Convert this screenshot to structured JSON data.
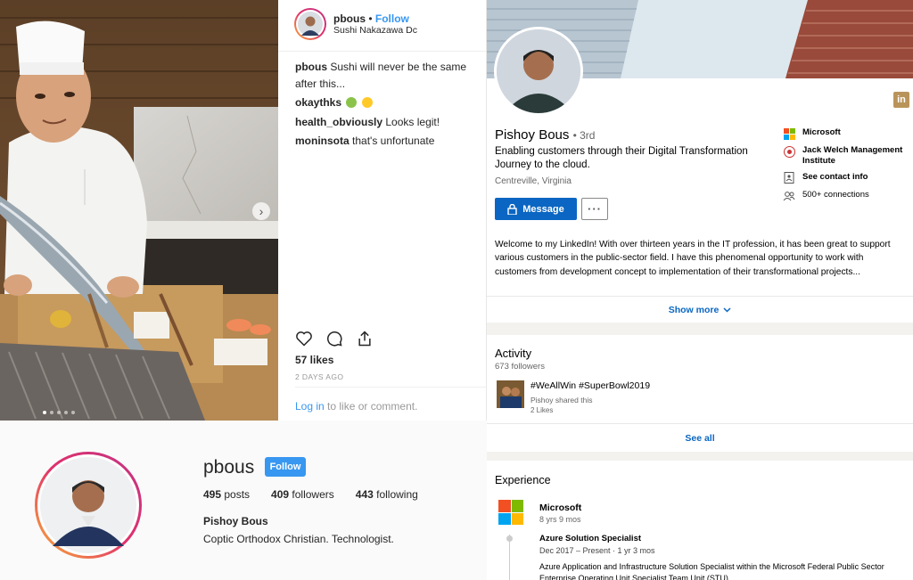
{
  "post": {
    "username": "pbous",
    "separator": "•",
    "follow_label": "Follow",
    "location": "Sushi Nakazawa Dc",
    "comments": [
      {
        "user": "pbous",
        "text": "Sushi will never be the same after this..."
      },
      {
        "user": "okaythks",
        "text": ""
      },
      {
        "user": "health_obviously",
        "text": "Looks legit!"
      },
      {
        "user": "moninsota",
        "text": "that's unfortunate"
      }
    ],
    "likes": "57 likes",
    "time_ago": "2 DAYS AGO",
    "login_link": "Log in",
    "login_rest": " to like or comment.",
    "carousel": {
      "total": 5,
      "active": 1
    },
    "emoji": [
      "green-face",
      "laughing-face"
    ]
  },
  "profile": {
    "username": "pbous",
    "follow_label": "Follow",
    "posts_count": "495",
    "posts_label": " posts",
    "followers_count": "409",
    "followers_label": " followers",
    "following_count": "443",
    "following_label": " following",
    "full_name": "Pishoy Bous",
    "bio": "Coptic Orthodox Christian. Technologist."
  },
  "linkedin": {
    "logo": "in",
    "name": "Pishoy Bous",
    "degree": "• 3rd",
    "headline": "Enabling customers through their Digital Transformation Journey to the cloud.",
    "location": "Centreville, Virginia",
    "message_label": "Message",
    "more_label": "···",
    "side": {
      "company": "Microsoft",
      "school": "Jack Welch Management Institute",
      "contact": "See contact info",
      "connections": "500+ connections"
    },
    "about": "Welcome to my LinkedIn! With over thirteen years in the IT profession, it has been great to support various customers in the public-sector field. I have this phenomenal opportunity to work with customers from development concept to implementation of their transformational projects...",
    "show_more": "Show more",
    "activity": {
      "title": "Activity",
      "followers": "673 followers",
      "post_text": "#WeAllWin #SuperBowl2019",
      "shared_by": "Pishoy shared this",
      "likes": "2 Likes",
      "see_all": "See all"
    },
    "experience": {
      "title": "Experience",
      "company": "Microsoft",
      "duration": "8 yrs 9 mos",
      "role": "Azure Solution Specialist",
      "role_dates": "Dec 2017 – Present · 1 yr 3 mos",
      "role_desc": "Azure Application and Infrastructure Solution Specialist within the Microsoft Federal Public Sector Enterprise Operating Unit Specialist Team Unit (STU)."
    },
    "colors": {
      "brand": "#0a66c2",
      "ms_red": "#f25022",
      "ms_green": "#7fba00",
      "ms_blue": "#00a4ef",
      "ms_yellow": "#ffb900"
    }
  },
  "colors": {
    "ig_blue": "#3897f0",
    "ig_text": "#262626"
  }
}
